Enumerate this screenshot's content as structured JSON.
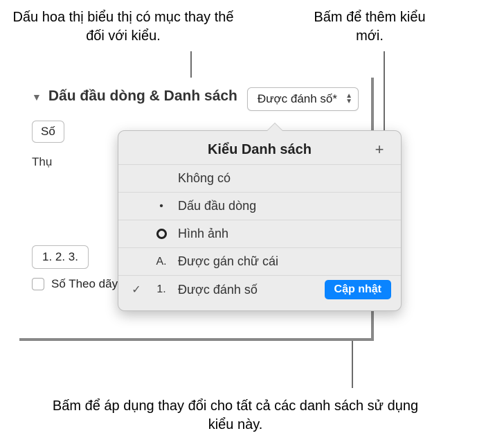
{
  "callouts": {
    "asterisk": "Dấu hoa thị biểu thị có mục thay thế đối với kiểu.",
    "add": "Bấm để thêm kiểu mới.",
    "update": "Bấm để áp dụng thay đổi cho tất cả các danh sách sử dụng kiểu này."
  },
  "panel": {
    "section_title": "Dấu đầu dòng & Danh sách",
    "style_selected": "Được đánh số*",
    "subtype": "Số",
    "indent_label": "Thụ",
    "format_sample": "1. 2. 3.",
    "sequence_label": "Số Theo dãy"
  },
  "popover": {
    "title": "Kiểu Danh sách",
    "add_symbol": "+",
    "options": [
      {
        "check": "",
        "icon": "",
        "label": "Không có"
      },
      {
        "check": "",
        "icon": "•",
        "label": "Dấu đầu dòng"
      },
      {
        "check": "",
        "icon": "ring",
        "label": "Hình ảnh"
      },
      {
        "check": "",
        "icon": "A.",
        "label": "Được gán chữ cái"
      },
      {
        "check": "✓",
        "icon": "1.",
        "label": "Được đánh số",
        "action": "Cập nhật"
      }
    ]
  }
}
